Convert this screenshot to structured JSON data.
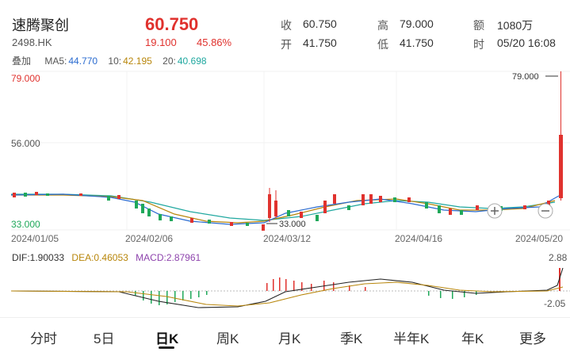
{
  "stock": {
    "name": "速腾聚创",
    "code": "2498.HK",
    "price": "60.750",
    "change": "19.100",
    "change_pct": "45.86%"
  },
  "quote": [
    {
      "label": "收",
      "value": "60.750"
    },
    {
      "label": "高",
      "value": "79.000"
    },
    {
      "label": "额",
      "value": "1080万"
    },
    {
      "label": "开",
      "value": "41.750"
    },
    {
      "label": "低",
      "value": "41.750"
    },
    {
      "label": "时",
      "value": "05/20 16:08"
    }
  ],
  "ma": {
    "overlay_label": "叠加",
    "ma5_label": "MA5:",
    "ma5_value": "44.770",
    "ma10_label": "10:",
    "ma10_value": "42.195",
    "ma20_label": "20:",
    "ma20_value": "40.698"
  },
  "chart": {
    "y_top": "79.000",
    "y_mid": "56.000",
    "y_bottom": "33.000",
    "high_marker": "79.000",
    "low_marker": "33.000",
    "x_labels": [
      "2024/01/05",
      "2024/02/06",
      "2024/03/12",
      "2024/04/16",
      "2024/05/20"
    ]
  },
  "macd": {
    "dif_label": "DIF:",
    "dif_value": "1.90033",
    "dea_label": "DEA:",
    "dea_value": "0.46053",
    "macd_label": "MACD:",
    "macd_value": "2.87961",
    "y_top": "2.88",
    "y_bottom": "-2.05"
  },
  "colors": {
    "up": "#e0322e",
    "down": "#1fa85a",
    "ma5": "#2a6bd0",
    "ma10": "#b8860b",
    "ma20": "#20a8a0"
  },
  "tabs": [
    "分时",
    "5日",
    "日K",
    "周K",
    "月K",
    "季K",
    "半年K",
    "年K",
    "更多"
  ],
  "active_tab": "日K"
}
